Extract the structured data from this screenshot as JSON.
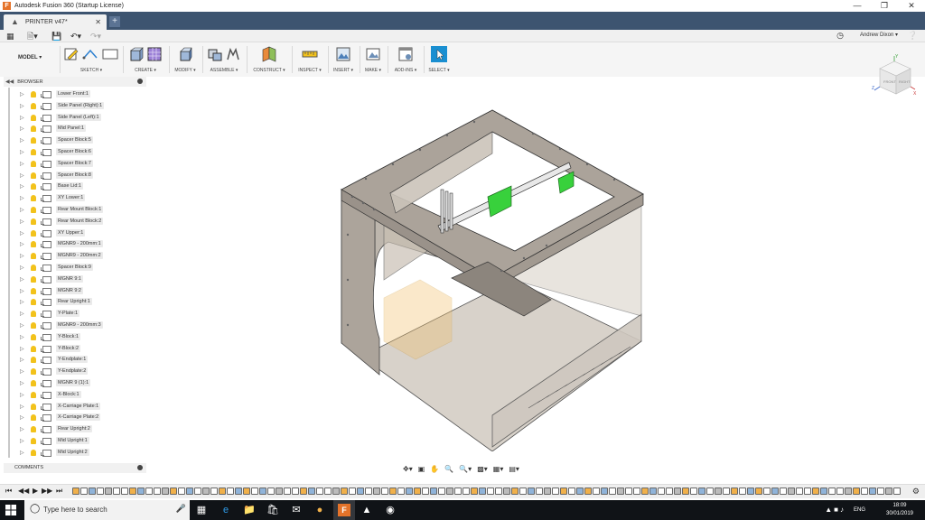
{
  "window": {
    "title": "Autodesk Fusion 360 (Startup License)",
    "app_icon": "F",
    "controls": [
      "—",
      "❐",
      "✕"
    ]
  },
  "tabs": [
    {
      "label": "PRINTER v47*",
      "close": "✕"
    }
  ],
  "new_tab_label": "+",
  "quick_access": {
    "user": "Andrew Dixon ▾"
  },
  "toolbar": {
    "mode": "MODEL ▾",
    "groups": [
      {
        "label": "SKETCH ▾"
      },
      {
        "label": "CREATE ▾"
      },
      {
        "label": "MODIFY ▾"
      },
      {
        "label": "ASSEMBLE ▾"
      },
      {
        "label": "CONSTRUCT ▾"
      },
      {
        "label": "INSPECT ▾"
      },
      {
        "label": "INSERT ▾"
      },
      {
        "label": "MAKE ▾"
      },
      {
        "label": "ADD-INS ▾"
      },
      {
        "label": "SELECT ▾"
      }
    ]
  },
  "browser": {
    "title": "BROWSER",
    "items": [
      "Lower Front:1",
      "Side Panel (Right):1",
      "Side Panel (Left):1",
      "Mid Panel:1",
      "Spacer Block:5",
      "Spacer Block:6",
      "Spacer Block:7",
      "Spacer Block:8",
      "Base Lid:1",
      "XY Lower:1",
      "Rear Mount Block:1",
      "Rear Mount Block:2",
      "XY Upper:1",
      "MGNR9 - 200mm:1",
      "MGNR9 - 200mm:2",
      "Spacer Block:9",
      "MGNR 9:1",
      "MGNR 9:2",
      "Rear Upright:1",
      "Y-Plate:1",
      "MGNR9 - 200mm:3",
      "Y-Block:1",
      "Y-Block:2",
      "Y-Endplate:1",
      "Y-Endplate:2",
      "MGNR 9 (1):1",
      "X-Block:1",
      "X-Carriage Plate:1",
      "X-Carriage Plate:2",
      "Rear Upright:2",
      "Mid Upright:1",
      "Mid Upright:2"
    ]
  },
  "comments": {
    "title": "COMMENTS"
  },
  "viewcube": {
    "front": "FRONT",
    "right": "RIGHT",
    "axis_x": "X",
    "axis_y": "Y",
    "axis_z": "Z"
  },
  "taskbar": {
    "search_placeholder": "Type here to search",
    "lang": "ENG",
    "time": "18:09",
    "date": "30/01/2019"
  },
  "colors": {
    "tabbar": "#3d5470",
    "accent_select": "#1a8fd1",
    "part_green": "#38d13c",
    "frame": "#a8a099",
    "taskbar": "#101317"
  }
}
